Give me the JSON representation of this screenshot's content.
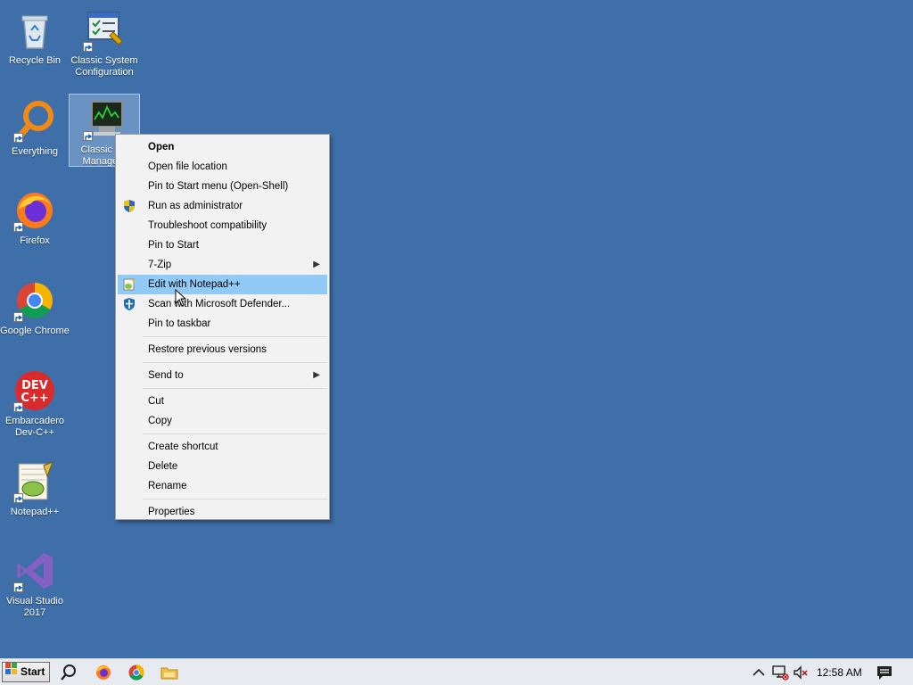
{
  "desktop": {
    "background": "#3e6fa8",
    "icons": [
      {
        "label": "Recycle Bin",
        "icon": "recycle-bin-icon"
      },
      {
        "label": "Classic System Configuration",
        "icon": "system-config-icon"
      },
      {
        "label": "Everything",
        "icon": "everything-search-icon"
      },
      {
        "label": "Classic Task Manager",
        "visible_label": "Classic T... Manage...",
        "icon": "task-manager-icon",
        "selected": true
      },
      {
        "label": "Firefox",
        "icon": "firefox-icon"
      },
      {
        "label": "Google Chrome",
        "icon": "chrome-icon"
      },
      {
        "label": "Embarcadero Dev-C++",
        "icon": "devcpp-icon"
      },
      {
        "label": "Notepad++",
        "icon": "notepadpp-icon"
      },
      {
        "label": "Visual Studio 2017",
        "icon": "visual-studio-icon"
      }
    ]
  },
  "context_menu": {
    "open": "Open",
    "open_file_location": "Open file location",
    "pin_start_openshell": "Pin to Start menu (Open-Shell)",
    "run_as_admin": "Run as administrator",
    "troubleshoot": "Troubleshoot compatibility",
    "pin_to_start": "Pin to Start",
    "seven_zip": "7-Zip",
    "edit_notepadpp": "Edit with Notepad++",
    "scan_defender": "Scan with Microsoft Defender...",
    "pin_taskbar": "Pin to taskbar",
    "restore_versions": "Restore previous versions",
    "send_to": "Send to",
    "cut": "Cut",
    "copy": "Copy",
    "create_shortcut": "Create shortcut",
    "delete": "Delete",
    "rename": "Rename",
    "properties": "Properties",
    "highlight_color": "#91c9f7"
  },
  "taskbar": {
    "start_label": "Start",
    "clock": "12:58 AM",
    "pinned": [
      "search-icon",
      "firefox-icon",
      "chrome-icon",
      "file-explorer-icon"
    ],
    "tray": [
      "chevron-up-icon",
      "network-icon",
      "volume-muted-icon",
      "notifications-icon"
    ]
  }
}
